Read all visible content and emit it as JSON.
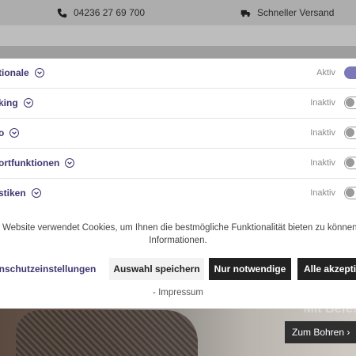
{
  "topbar": {
    "phone": "04236 27 69 700",
    "shipping": "Schneller Versand",
    "phone_icon": "phone-icon",
    "shipping_icon": "truck-icon"
  },
  "cookie_modal": {
    "categories": [
      {
        "label": "tionale",
        "status": "Aktiv",
        "enabled": true
      },
      {
        "label": "king",
        "status": "Inaktiv",
        "enabled": false
      },
      {
        "label": "o",
        "status": "Inaktiv",
        "enabled": false
      },
      {
        "label": "ortfunktionen",
        "status": "Inaktiv",
        "enabled": false
      },
      {
        "label": "stiken",
        "status": "Inaktiv",
        "enabled": false
      }
    ],
    "info_line1": "Website verwendet Cookies, um Ihnen die bestmögliche Funktionalität bieten zu können...",
    "info_line2": "Informationen.",
    "buttons": {
      "privacy": "tenschutzeinstellungen",
      "save": "Auswahl speichern",
      "necessary": "Nur notwendige",
      "all": "Alle akzeptie"
    },
    "imprint": "- Impressum"
  },
  "hero": {
    "cta": "Zum Bohren ›",
    "caption": "Mit Befest"
  },
  "colors": {
    "accent": "#3d3770",
    "toggle_on": "#7d78b8",
    "dark_button": "#222222"
  }
}
